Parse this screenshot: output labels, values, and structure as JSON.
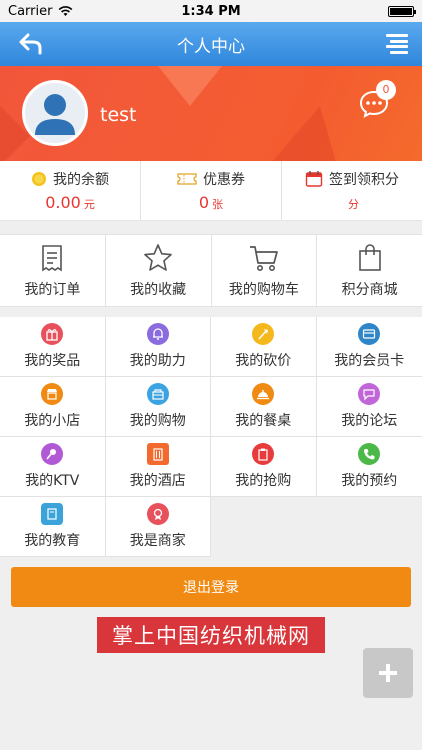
{
  "status_bar": {
    "carrier": "Carrier",
    "time": "1:34 PM",
    "battery_level": 1.0
  },
  "nav": {
    "title": "个人中心",
    "back_icon": "back-arrow-icon",
    "menu_icon": "menu-icon"
  },
  "profile": {
    "username": "test",
    "message_badge": "0",
    "accent": "#f2563a"
  },
  "stats": [
    {
      "label": "我的余额",
      "value": "0.00",
      "unit": "元",
      "icon": "coin-icon"
    },
    {
      "label": "优惠券",
      "value": "0",
      "unit": "张",
      "icon": "coupon-icon"
    },
    {
      "label": "签到领积分",
      "value": "",
      "unit": "分",
      "icon": "calendar-icon"
    }
  ],
  "shortcuts": [
    {
      "label": "我的订单",
      "icon": "order-icon"
    },
    {
      "label": "我的收藏",
      "icon": "star-icon"
    },
    {
      "label": "我的购物车",
      "icon": "cart-icon"
    },
    {
      "label": "积分商城",
      "icon": "bag-icon"
    }
  ],
  "services": [
    {
      "label": "我的奖品",
      "icon": "gift-icon",
      "color": "#e8505b"
    },
    {
      "label": "我的助力",
      "icon": "bell-icon",
      "color": "#8a6be0"
    },
    {
      "label": "我的砍价",
      "icon": "axe-icon",
      "color": "#f5b81c"
    },
    {
      "label": "我的会员卡",
      "icon": "card-icon",
      "color": "#2e86c8"
    },
    {
      "label": "我的小店",
      "icon": "shop-icon",
      "color": "#f08a12"
    },
    {
      "label": "我的购物",
      "icon": "basket-icon",
      "color": "#3aa3e0"
    },
    {
      "label": "我的餐桌",
      "icon": "dish-icon",
      "color": "#f08a12"
    },
    {
      "label": "我的论坛",
      "icon": "chat-icon",
      "color": "#c066d8"
    },
    {
      "label": "我的KTV",
      "icon": "mic-icon",
      "color": "#b25ad6"
    },
    {
      "label": "我的酒店",
      "icon": "hotel-icon",
      "color": "#f26a2d"
    },
    {
      "label": "我的抢购",
      "icon": "clipboard-icon",
      "color": "#e83b3b"
    },
    {
      "label": "我的预约",
      "icon": "phone-icon",
      "color": "#4cb848"
    },
    {
      "label": "我的教育",
      "icon": "book-icon",
      "color": "#3aa3d9"
    },
    {
      "label": "我是商家",
      "icon": "ribbon-icon",
      "color": "#e8505b"
    }
  ],
  "logout_label": "退出登录",
  "banner_text": "掌上中国纺织机械网",
  "fab_icon": "plus-icon"
}
